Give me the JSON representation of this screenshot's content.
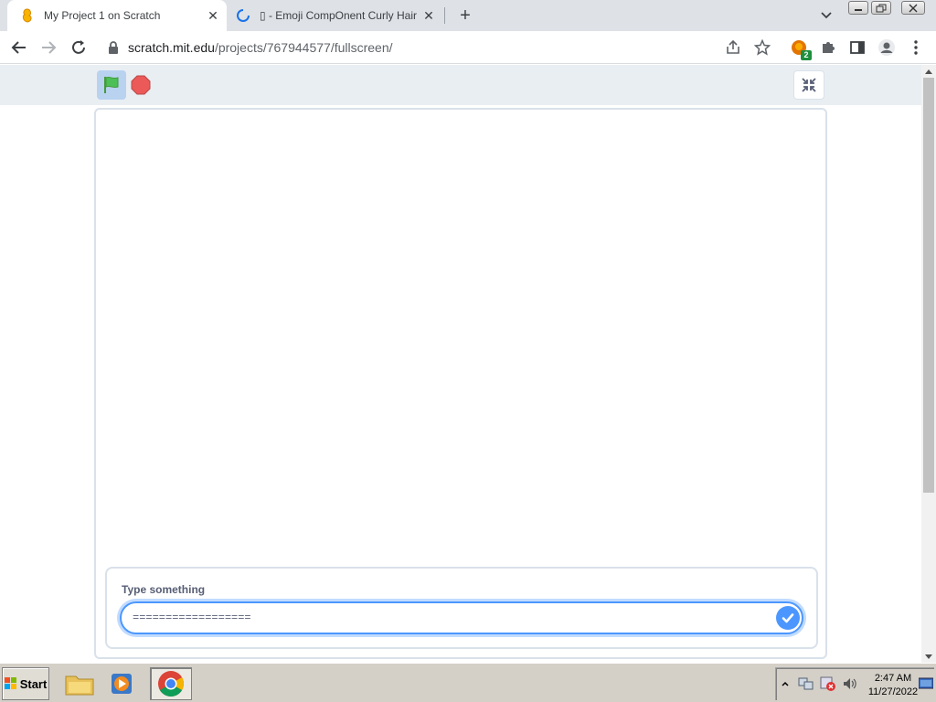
{
  "browser": {
    "tabs": [
      {
        "title": "My Project 1 on Scratch",
        "active": true
      },
      {
        "title": "▯ - Emoji CompOnent Curly Hair",
        "active": false
      }
    ],
    "url": {
      "host": "scratch.mit.edu",
      "path": "/projects/767944577/fullscreen/"
    },
    "extension_badge": "2"
  },
  "scratch": {
    "ask_prompt": "Type something",
    "ask_value": "=================="
  },
  "taskbar": {
    "start_label": "Start",
    "time": "2:47 AM",
    "date": "11/27/2022"
  },
  "colors": {
    "scratch_blue": "#4c97ff",
    "flag_green": "#4cbf56",
    "stop_red": "#ec5959",
    "stage_border": "#d9e1ea"
  }
}
